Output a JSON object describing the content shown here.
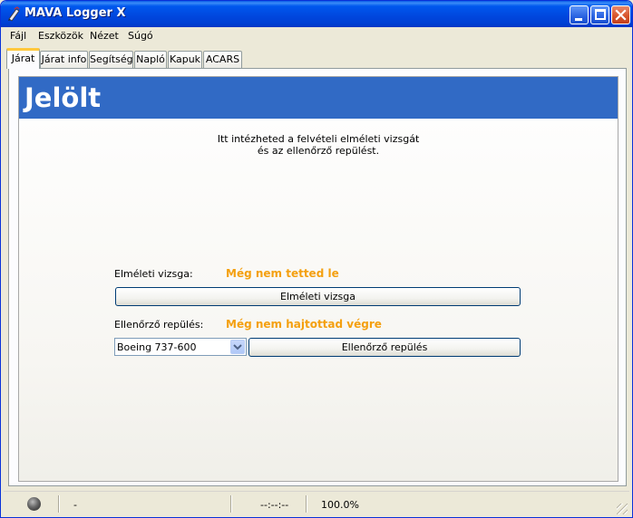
{
  "window": {
    "title": "MAVA Logger X",
    "app_icon": "pen-icon",
    "controls": {
      "minimize": "minimize-icon",
      "maximize": "maximize-icon",
      "close": "close-icon"
    }
  },
  "menu": {
    "items": [
      {
        "label": "Fájl"
      },
      {
        "label": "Eszközök"
      },
      {
        "label": "Nézet"
      },
      {
        "label": "Súgó"
      }
    ]
  },
  "tabs": {
    "items": [
      {
        "label": "Járat",
        "active": true
      },
      {
        "label": "Járat info"
      },
      {
        "label": "Segítség"
      },
      {
        "label": "Napló"
      },
      {
        "label": "Kapuk"
      },
      {
        "label": "ACARS"
      }
    ]
  },
  "page": {
    "header_title": "Jelölt",
    "header_color": "#316ac5",
    "intro_line1": "Itt intézheted a felvételi elméleti vizsgát",
    "intro_line2": "és az ellenőrző repülést.",
    "theory": {
      "label": "Elméleti vizsga:",
      "status": "Még nem tetted le",
      "button": "Elméleti vizsga"
    },
    "checkflight": {
      "label": "Ellenőrző repülés:",
      "status": "Még nem hajtottad végre",
      "aircraft_selected": "Boeing 737-600",
      "button": "Ellenőrző repülés"
    },
    "status_color": "#f4a010"
  },
  "statusbar": {
    "indicator": "connection-led-icon",
    "text": "-",
    "time": "--:--:--",
    "progress": "100.0%"
  }
}
